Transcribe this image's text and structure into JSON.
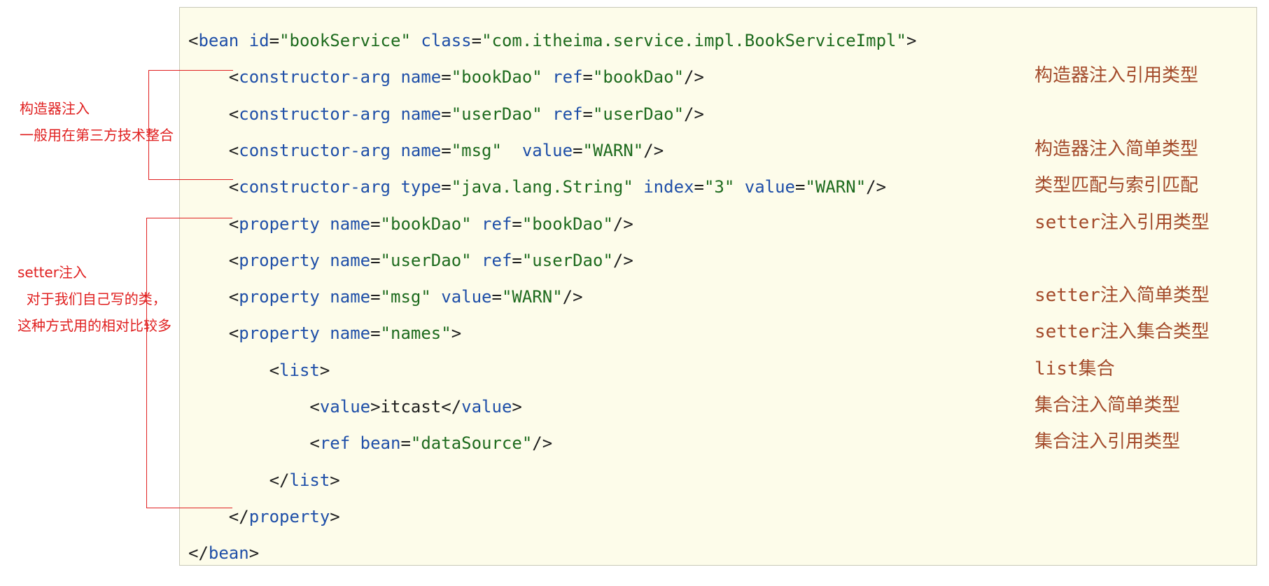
{
  "code_lines": [
    {
      "tokens": [
        {
          "t": "<",
          "c": "tag"
        },
        {
          "t": "bean ",
          "c": "name"
        },
        {
          "t": "id",
          "c": "name"
        },
        {
          "t": "=",
          "c": "eq"
        },
        {
          "t": "\"bookService\"",
          "c": "str"
        },
        {
          "t": " class",
          "c": "name"
        },
        {
          "t": "=",
          "c": "eq"
        },
        {
          "t": "\"com.itheima.service.impl.BookServiceImpl\"",
          "c": "str"
        },
        {
          "t": ">",
          "c": "tag"
        }
      ]
    },
    {
      "tokens": [
        {
          "t": "    <",
          "c": "tag"
        },
        {
          "t": "constructor-arg ",
          "c": "name"
        },
        {
          "t": "name",
          "c": "name"
        },
        {
          "t": "=",
          "c": "eq"
        },
        {
          "t": "\"bookDao\"",
          "c": "str"
        },
        {
          "t": " ref",
          "c": "name"
        },
        {
          "t": "=",
          "c": "eq"
        },
        {
          "t": "\"bookDao\"",
          "c": "str"
        },
        {
          "t": "/>",
          "c": "tag"
        }
      ]
    },
    {
      "tokens": [
        {
          "t": "    <",
          "c": "tag"
        },
        {
          "t": "constructor-arg ",
          "c": "name"
        },
        {
          "t": "name",
          "c": "name"
        },
        {
          "t": "=",
          "c": "eq"
        },
        {
          "t": "\"userDao\"",
          "c": "str"
        },
        {
          "t": " ref",
          "c": "name"
        },
        {
          "t": "=",
          "c": "eq"
        },
        {
          "t": "\"userDao\"",
          "c": "str"
        },
        {
          "t": "/>",
          "c": "tag"
        }
      ]
    },
    {
      "tokens": [
        {
          "t": "    <",
          "c": "tag"
        },
        {
          "t": "constructor-arg ",
          "c": "name"
        },
        {
          "t": "name",
          "c": "name"
        },
        {
          "t": "=",
          "c": "eq"
        },
        {
          "t": "\"msg\"",
          "c": "str"
        },
        {
          "t": "  value",
          "c": "name"
        },
        {
          "t": "=",
          "c": "eq"
        },
        {
          "t": "\"WARN\"",
          "c": "str"
        },
        {
          "t": "/>",
          "c": "tag"
        }
      ]
    },
    {
      "tokens": [
        {
          "t": "    <",
          "c": "tag"
        },
        {
          "t": "constructor-arg ",
          "c": "name"
        },
        {
          "t": "type",
          "c": "name"
        },
        {
          "t": "=",
          "c": "eq"
        },
        {
          "t": "\"java.lang.String\"",
          "c": "str"
        },
        {
          "t": " index",
          "c": "name"
        },
        {
          "t": "=",
          "c": "eq"
        },
        {
          "t": "\"3\"",
          "c": "str"
        },
        {
          "t": " value",
          "c": "name"
        },
        {
          "t": "=",
          "c": "eq"
        },
        {
          "t": "\"WARN\"",
          "c": "str"
        },
        {
          "t": "/>",
          "c": "tag"
        }
      ]
    },
    {
      "tokens": [
        {
          "t": "    <",
          "c": "tag"
        },
        {
          "t": "property ",
          "c": "name"
        },
        {
          "t": "name",
          "c": "name"
        },
        {
          "t": "=",
          "c": "eq"
        },
        {
          "t": "\"bookDao\"",
          "c": "str"
        },
        {
          "t": " ref",
          "c": "name"
        },
        {
          "t": "=",
          "c": "eq"
        },
        {
          "t": "\"bookDao\"",
          "c": "str"
        },
        {
          "t": "/>",
          "c": "tag"
        }
      ]
    },
    {
      "tokens": [
        {
          "t": "    <",
          "c": "tag"
        },
        {
          "t": "property ",
          "c": "name"
        },
        {
          "t": "name",
          "c": "name"
        },
        {
          "t": "=",
          "c": "eq"
        },
        {
          "t": "\"userDao\"",
          "c": "str"
        },
        {
          "t": " ref",
          "c": "name"
        },
        {
          "t": "=",
          "c": "eq"
        },
        {
          "t": "\"userDao\"",
          "c": "str"
        },
        {
          "t": "/>",
          "c": "tag"
        }
      ]
    },
    {
      "tokens": [
        {
          "t": "    <",
          "c": "tag"
        },
        {
          "t": "property ",
          "c": "name"
        },
        {
          "t": "name",
          "c": "name"
        },
        {
          "t": "=",
          "c": "eq"
        },
        {
          "t": "\"msg\"",
          "c": "str"
        },
        {
          "t": " value",
          "c": "name"
        },
        {
          "t": "=",
          "c": "eq"
        },
        {
          "t": "\"WARN\"",
          "c": "str"
        },
        {
          "t": "/>",
          "c": "tag"
        }
      ]
    },
    {
      "tokens": [
        {
          "t": "    <",
          "c": "tag"
        },
        {
          "t": "property ",
          "c": "name"
        },
        {
          "t": "name",
          "c": "name"
        },
        {
          "t": "=",
          "c": "eq"
        },
        {
          "t": "\"names\"",
          "c": "str"
        },
        {
          "t": ">",
          "c": "tag"
        }
      ]
    },
    {
      "tokens": [
        {
          "t": "        <",
          "c": "tag"
        },
        {
          "t": "list",
          "c": "name"
        },
        {
          "t": ">",
          "c": "tag"
        }
      ]
    },
    {
      "tokens": [
        {
          "t": "            <",
          "c": "tag"
        },
        {
          "t": "value",
          "c": "name"
        },
        {
          "t": ">",
          "c": "tag"
        },
        {
          "t": "itcast",
          "c": "text"
        },
        {
          "t": "</",
          "c": "tag"
        },
        {
          "t": "value",
          "c": "name"
        },
        {
          "t": ">",
          "c": "tag"
        }
      ]
    },
    {
      "tokens": [
        {
          "t": "            <",
          "c": "tag"
        },
        {
          "t": "ref ",
          "c": "name"
        },
        {
          "t": "bean",
          "c": "name"
        },
        {
          "t": "=",
          "c": "eq"
        },
        {
          "t": "\"dataSource\"",
          "c": "str"
        },
        {
          "t": "/>",
          "c": "tag"
        }
      ]
    },
    {
      "tokens": [
        {
          "t": "        </",
          "c": "tag"
        },
        {
          "t": "list",
          "c": "name"
        },
        {
          "t": ">",
          "c": "tag"
        }
      ]
    },
    {
      "tokens": [
        {
          "t": "    </",
          "c": "tag"
        },
        {
          "t": "property",
          "c": "name"
        },
        {
          "t": ">",
          "c": "tag"
        }
      ]
    },
    {
      "tokens": [
        {
          "t": "</",
          "c": "tag"
        },
        {
          "t": "bean",
          "c": "name"
        },
        {
          "t": ">",
          "c": "tag"
        }
      ]
    }
  ],
  "notes": [
    {
      "text": "构造器注入引用类型",
      "line": 1,
      "mono": false
    },
    {
      "text": "构造器注入简单类型",
      "line": 3,
      "mono": false
    },
    {
      "text": "类型匹配与索引匹配",
      "line": 4,
      "mono": false
    },
    {
      "text": "setter注入引用类型",
      "line": 5,
      "mono": true
    },
    {
      "text": "setter注入简单类型",
      "line": 7,
      "mono": true
    },
    {
      "text": "setter注入集合类型",
      "line": 8,
      "mono": true
    },
    {
      "text": "list集合",
      "line": 9,
      "mono": true
    },
    {
      "text": "集合注入简单类型",
      "line": 10,
      "mono": false
    },
    {
      "text": "集合注入引用类型",
      "line": 11,
      "mono": false
    }
  ],
  "side_notes": {
    "constructor": {
      "title": "构造器注入",
      "desc": "一般用在第三方技术整合"
    },
    "setter": {
      "title": "setter注入",
      "desc1": "  对于我们自己写的类，",
      "desc2": "这种方式用的相对比较多"
    }
  },
  "colors": {
    "background": "#fdfcea",
    "tag": "#1f1f1f",
    "attr_name": "#1f4fa8",
    "string": "#1e6b1e",
    "note": "#a34a2a",
    "side_note": "#e02020"
  }
}
